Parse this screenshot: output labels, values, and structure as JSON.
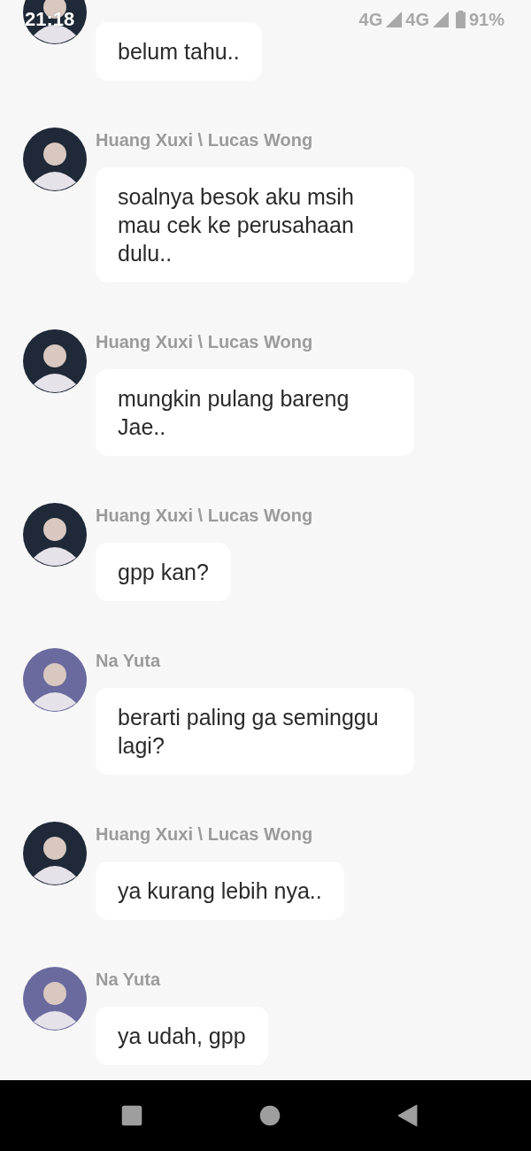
{
  "status_bar": {
    "time": "21:18",
    "network_1": "4G",
    "network_2": "4G",
    "battery": "91%"
  },
  "messages": [
    {
      "color": "#1f2937",
      "text": "belum tahu.."
    },
    {
      "sender": "Huang Xuxi \\ Lucas Wong",
      "color": "#1f2937",
      "text": "soalnya besok aku msih mau cek ke perusahaan dulu.."
    },
    {
      "sender": "Huang Xuxi \\ Lucas Wong",
      "color": "#1f2937",
      "text": "mungkin pulang bareng Jae.."
    },
    {
      "sender": "Huang Xuxi \\ Lucas Wong",
      "color": "#1f2937",
      "text": "gpp kan?"
    },
    {
      "sender": "Na Yuta",
      "color": "#6b6a9e",
      "text": "berarti paling ga seminggu lagi?"
    },
    {
      "sender": "Huang Xuxi \\ Lucas Wong",
      "color": "#1f2937",
      "text": "ya kurang lebih nya.."
    },
    {
      "sender": "Na Yuta",
      "color": "#6b6a9e",
      "text": "ya udah, gpp"
    }
  ]
}
